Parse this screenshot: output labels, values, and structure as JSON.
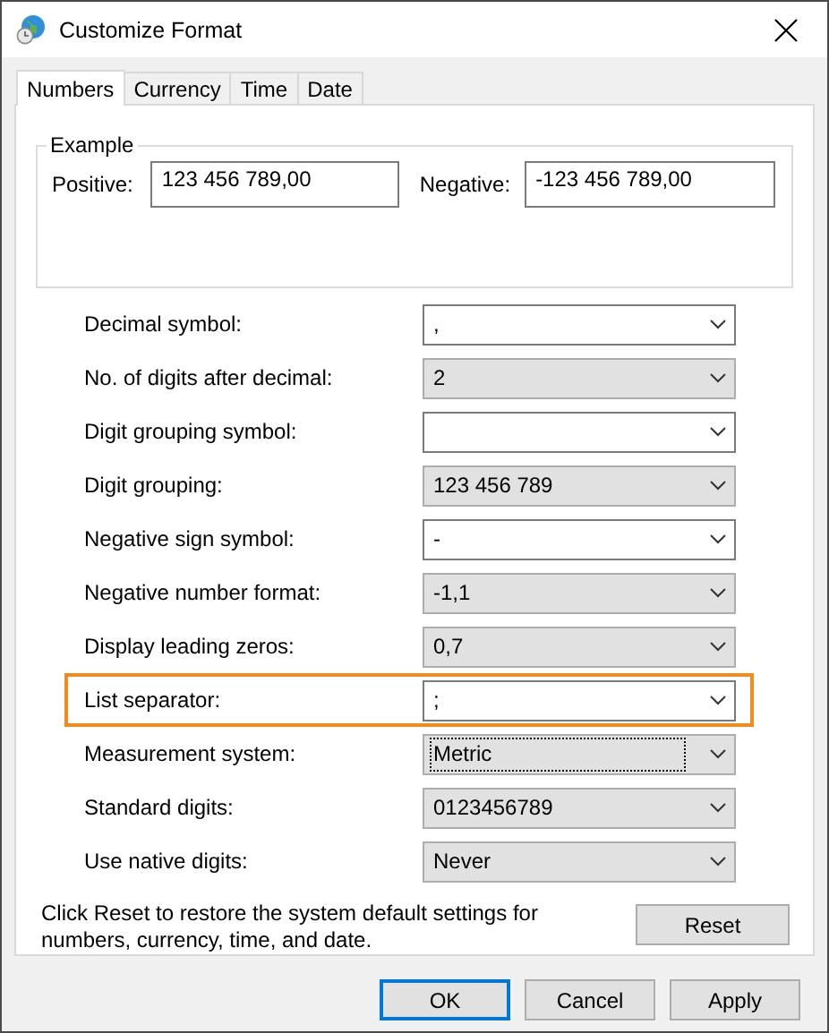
{
  "window": {
    "title": "Customize Format"
  },
  "tabs": [
    {
      "label": "Numbers",
      "selected": true
    },
    {
      "label": "Currency",
      "selected": false
    },
    {
      "label": "Time",
      "selected": false
    },
    {
      "label": "Date",
      "selected": false
    }
  ],
  "example": {
    "title": "Example",
    "positive_label": "Positive:",
    "positive_value": "123 456 789,00",
    "negative_label": "Negative:",
    "negative_value": "-123 456 789,00"
  },
  "settings": [
    {
      "label": "Decimal symbol:",
      "value": ",",
      "kind": "editable",
      "highlighted": false,
      "focused": false
    },
    {
      "label": "No. of digits after decimal:",
      "value": "2",
      "kind": "list",
      "highlighted": false,
      "focused": false
    },
    {
      "label": "Digit grouping symbol:",
      "kind": "editable",
      "highlighted": false,
      "focused": false
    },
    {
      "label": "Digit grouping:",
      "value": "123 456 789",
      "kind": "list",
      "highlighted": false,
      "focused": false
    },
    {
      "label": "Negative sign symbol:",
      "value": "-",
      "kind": "editable",
      "highlighted": false,
      "focused": false
    },
    {
      "label": "Negative number format:",
      "value": "-1,1",
      "kind": "list",
      "highlighted": false,
      "focused": false
    },
    {
      "label": "Display leading zeros:",
      "value": "0,7",
      "kind": "list",
      "highlighted": false,
      "focused": false
    },
    {
      "label": "List separator:",
      "value": ";",
      "kind": "editable",
      "highlighted": true,
      "focused": false
    },
    {
      "label": "Measurement system:",
      "value": "Metric",
      "kind": "list",
      "highlighted": false,
      "focused": true
    },
    {
      "label": "Standard digits:",
      "value": "0123456789",
      "kind": "list",
      "highlighted": false,
      "focused": false
    },
    {
      "label": "Use native digits:",
      "value": "Never",
      "kind": "list",
      "highlighted": false,
      "focused": false
    }
  ],
  "reset_note": "Click Reset to restore the system default settings for numbers, currency, time, and date.",
  "reset_button": "Reset",
  "buttons": [
    {
      "label": "OK",
      "default": true
    },
    {
      "label": "Cancel",
      "default": false
    },
    {
      "label": "Apply",
      "default": false
    }
  ]
}
